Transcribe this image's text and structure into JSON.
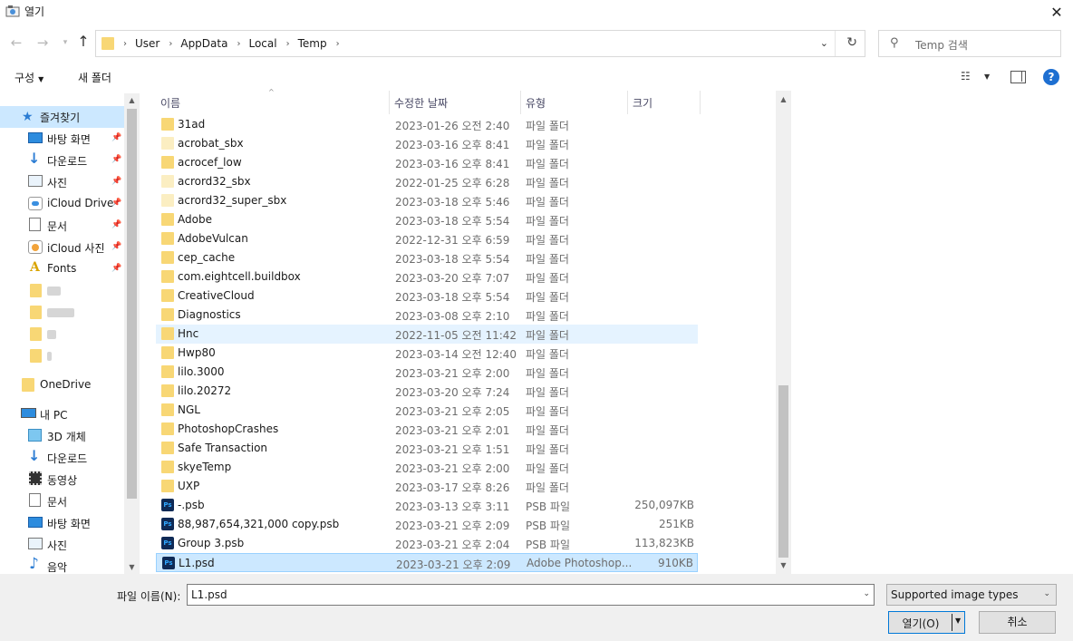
{
  "window": {
    "title": "열기",
    "close_glyph": "✕"
  },
  "nav": {
    "back": "←",
    "forward": "→",
    "recent": "⌄",
    "up": "↑",
    "crumbs": [
      "User",
      "AppData",
      "Local",
      "Temp"
    ],
    "search_placeholder": "Temp 검색"
  },
  "toolbar": {
    "organize": "구성",
    "new_folder": "새 폴더"
  },
  "navpane": {
    "items": [
      {
        "label": "즐겨찾기",
        "icon": "star-icon"
      },
      {
        "label": "바탕 화면",
        "icon": "desktop-icon",
        "pinned": true
      },
      {
        "label": "다운로드",
        "icon": "download-icon",
        "pinned": true
      },
      {
        "label": "사진",
        "icon": "pictures-icon",
        "pinned": true
      },
      {
        "label": "iCloud Drive",
        "icon": "icloud-icon",
        "pinned": true
      },
      {
        "label": "문서",
        "icon": "documents-icon",
        "pinned": true
      },
      {
        "label": "iCloud 사진",
        "icon": "icloud-photos-icon",
        "pinned": true
      },
      {
        "label": "Fonts",
        "icon": "fonts-icon",
        "pinned": true
      },
      {
        "label": "OneDrive",
        "icon": "folder-icon"
      },
      {
        "label": "내 PC",
        "icon": "pc-icon"
      },
      {
        "label": "3D 개체",
        "icon": "3d-objects-icon"
      },
      {
        "label": "다운로드",
        "icon": "download-icon"
      },
      {
        "label": "동영상",
        "icon": "video-icon"
      },
      {
        "label": "문서",
        "icon": "documents-icon"
      },
      {
        "label": "바탕 화면",
        "icon": "desktop-icon"
      },
      {
        "label": "사진",
        "icon": "pictures-icon"
      },
      {
        "label": "음악",
        "icon": "music-icon"
      }
    ]
  },
  "columns": {
    "name": "이름",
    "date": "수정한 날짜",
    "type": "유형",
    "size": "크기"
  },
  "files": [
    {
      "name": "31ad",
      "date": "2023-01-26 오전 2:40",
      "type": "파일 폴더",
      "size": "",
      "kind": "folder"
    },
    {
      "name": "acrobat_sbx",
      "date": "2023-03-16 오후 8:41",
      "type": "파일 폴더",
      "size": "",
      "kind": "folder-pale"
    },
    {
      "name": "acrocef_low",
      "date": "2023-03-16 오후 8:41",
      "type": "파일 폴더",
      "size": "",
      "kind": "folder"
    },
    {
      "name": "acrord32_sbx",
      "date": "2022-01-25 오후 6:28",
      "type": "파일 폴더",
      "size": "",
      "kind": "folder-pale"
    },
    {
      "name": "acrord32_super_sbx",
      "date": "2023-03-18 오후 5:46",
      "type": "파일 폴더",
      "size": "",
      "kind": "folder-pale"
    },
    {
      "name": "Adobe",
      "date": "2023-03-18 오후 5:54",
      "type": "파일 폴더",
      "size": "",
      "kind": "folder"
    },
    {
      "name": "AdobeVulcan",
      "date": "2022-12-31 오후 6:59",
      "type": "파일 폴더",
      "size": "",
      "kind": "folder"
    },
    {
      "name": "cep_cache",
      "date": "2023-03-18 오후 5:54",
      "type": "파일 폴더",
      "size": "",
      "kind": "folder"
    },
    {
      "name": "com.eightcell.buildbox",
      "date": "2023-03-20 오후 7:07",
      "type": "파일 폴더",
      "size": "",
      "kind": "folder"
    },
    {
      "name": "CreativeCloud",
      "date": "2023-03-18 오후 5:54",
      "type": "파일 폴더",
      "size": "",
      "kind": "folder"
    },
    {
      "name": "Diagnostics",
      "date": "2023-03-08 오후 2:10",
      "type": "파일 폴더",
      "size": "",
      "kind": "folder"
    },
    {
      "name": "Hnc",
      "date": "2022-11-05 오전 11:42",
      "type": "파일 폴더",
      "size": "",
      "kind": "folder",
      "state": "hover"
    },
    {
      "name": "Hwp80",
      "date": "2023-03-14 오전 12:40",
      "type": "파일 폴더",
      "size": "",
      "kind": "folder"
    },
    {
      "name": "lilo.3000",
      "date": "2023-03-21 오후 2:00",
      "type": "파일 폴더",
      "size": "",
      "kind": "folder"
    },
    {
      "name": "lilo.20272",
      "date": "2023-03-20 오후 7:24",
      "type": "파일 폴더",
      "size": "",
      "kind": "folder"
    },
    {
      "name": "NGL",
      "date": "2023-03-21 오후 2:05",
      "type": "파일 폴더",
      "size": "",
      "kind": "folder"
    },
    {
      "name": "PhotoshopCrashes",
      "date": "2023-03-21 오후 2:01",
      "type": "파일 폴더",
      "size": "",
      "kind": "folder"
    },
    {
      "name": "Safe Transaction",
      "date": "2023-03-21 오후 1:51",
      "type": "파일 폴더",
      "size": "",
      "kind": "folder"
    },
    {
      "name": "skyeTemp",
      "date": "2023-03-21 오후 2:00",
      "type": "파일 폴더",
      "size": "",
      "kind": "folder"
    },
    {
      "name": "UXP",
      "date": "2023-03-17 오후 8:26",
      "type": "파일 폴더",
      "size": "",
      "kind": "folder"
    },
    {
      "name": "-.psb",
      "date": "2023-03-13 오후 3:11",
      "type": "PSB 파일",
      "size": "250,097KB",
      "kind": "psb"
    },
    {
      "name": "88,987,654,321,000 copy.psb",
      "date": "2023-03-21 오후 2:09",
      "type": "PSB 파일",
      "size": "251KB",
      "kind": "psb"
    },
    {
      "name": "Group 3.psb",
      "date": "2023-03-21 오후 2:04",
      "type": "PSB 파일",
      "size": "113,823KB",
      "kind": "psb"
    },
    {
      "name": "L1.psd",
      "date": "2023-03-21 오후 2:09",
      "type": "Adobe Photoshop...",
      "size": "910KB",
      "kind": "psb",
      "state": "selected"
    }
  ],
  "bottom": {
    "filename_label": "파일 이름(N):",
    "filename_value": "L1.psd",
    "filetype": "Supported image types",
    "open": "열기(O)",
    "cancel": "취소"
  },
  "colors": {
    "accent": "#0078d7",
    "selection": "#cce8ff",
    "hover": "#e5f3ff",
    "folder": "#f8d775"
  }
}
